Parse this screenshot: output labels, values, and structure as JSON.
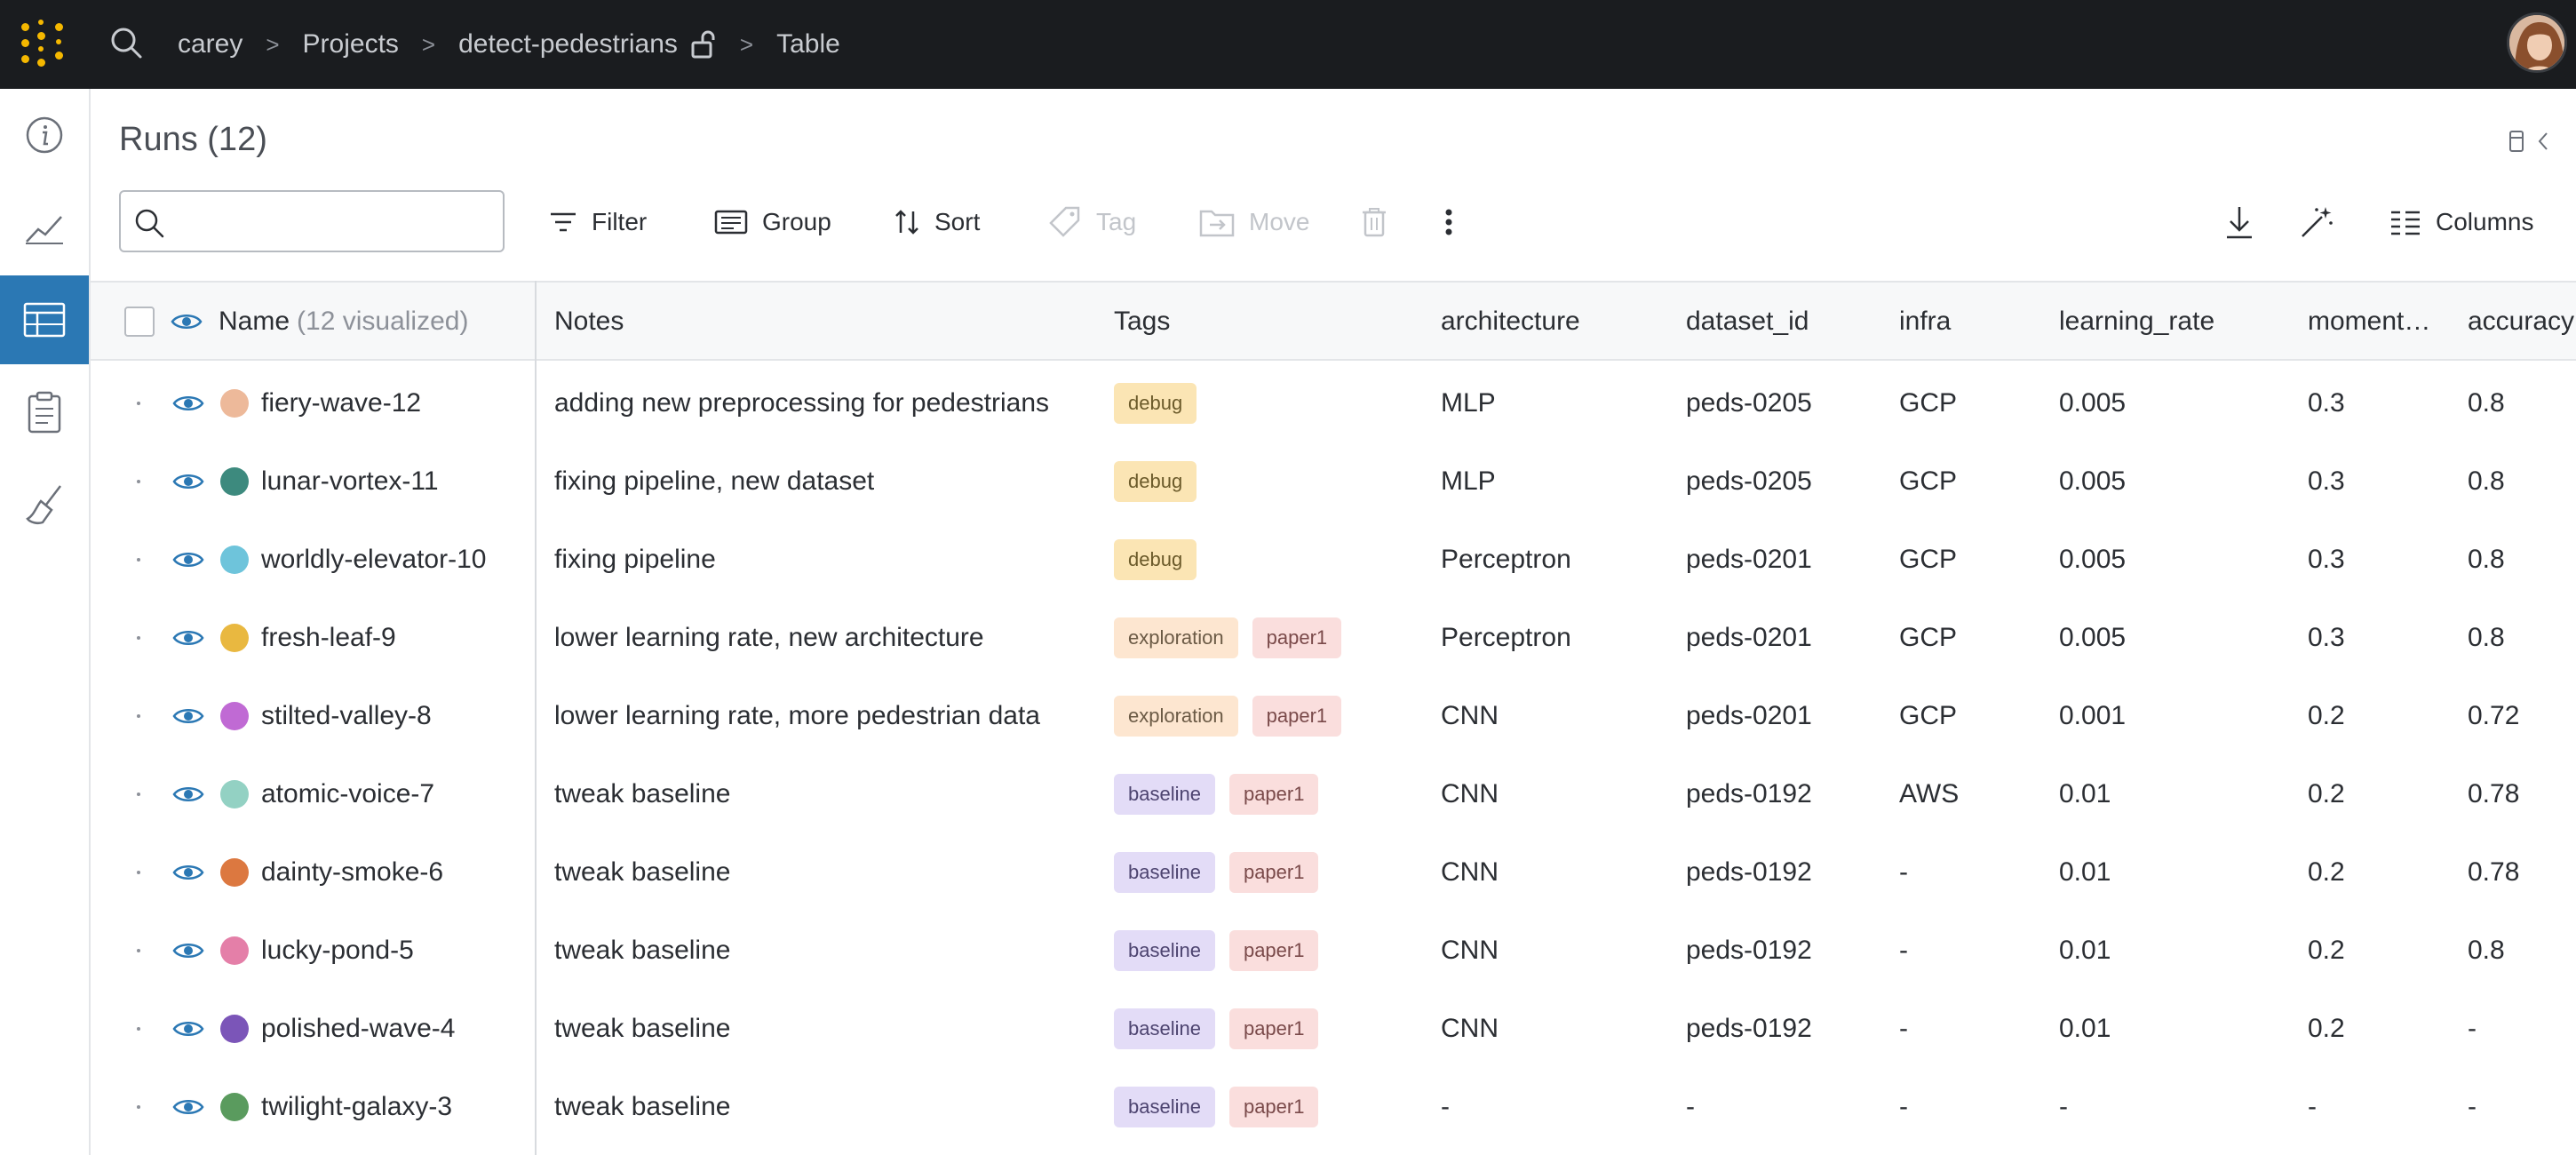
{
  "topbar": {
    "breadcrumbs": [
      "carey",
      "Projects",
      "detect-pedestrians",
      "Table"
    ]
  },
  "header": {
    "title": "Runs",
    "count": "(12)"
  },
  "search": {
    "placeholder": ""
  },
  "toolbar": {
    "filter": "Filter",
    "group": "Group",
    "sort": "Sort",
    "tag": "Tag",
    "move": "Move",
    "columns": "Columns"
  },
  "columns": {
    "name": "Name",
    "name_sub": "(12 visualized)",
    "notes": "Notes",
    "tags": "Tags",
    "architecture": "architecture",
    "dataset_id": "dataset_id",
    "infra": "infra",
    "learning_rate": "learning_rate",
    "momentum": "moment…",
    "accuracy": "accuracy"
  },
  "colors": {
    "topbar": "#1a1c1f",
    "accent": "#2b78b4",
    "logo": "#f5b800",
    "tag_debug_bg": "#fbe5b4",
    "tag_exploration_bg": "#fde6d0",
    "tag_paper1_bg": "#fadedd",
    "tag_baseline_bg": "#e3dcf7"
  },
  "rows": [
    {
      "name": "fiery-wave-12",
      "color": "#edb99a",
      "notes": "adding new preprocessing for pedestrians",
      "tags": [
        "debug"
      ],
      "architecture": "MLP",
      "dataset_id": "peds-0205",
      "infra": "GCP",
      "learning_rate": "0.005",
      "momentum": "0.3",
      "accuracy": "0.8"
    },
    {
      "name": "lunar-vortex-11",
      "color": "#3d8a7e",
      "notes": "fixing pipeline, new dataset",
      "tags": [
        "debug"
      ],
      "architecture": "MLP",
      "dataset_id": "peds-0205",
      "infra": "GCP",
      "learning_rate": "0.005",
      "momentum": "0.3",
      "accuracy": "0.8"
    },
    {
      "name": "worldly-elevator-10",
      "color": "#6ec4db",
      "notes": "fixing pipeline",
      "tags": [
        "debug"
      ],
      "architecture": "Perceptron",
      "dataset_id": "peds-0201",
      "infra": "GCP",
      "learning_rate": "0.005",
      "momentum": "0.3",
      "accuracy": "0.8"
    },
    {
      "name": "fresh-leaf-9",
      "color": "#e9b840",
      "notes": "lower learning rate, new architecture",
      "tags": [
        "exploration",
        "paper1"
      ],
      "architecture": "Perceptron",
      "dataset_id": "peds-0201",
      "infra": "GCP",
      "learning_rate": "0.005",
      "momentum": "0.3",
      "accuracy": "0.8"
    },
    {
      "name": "stilted-valley-8",
      "color": "#c06ad4",
      "notes": "lower learning rate, more pedestrian data",
      "tags": [
        "exploration",
        "paper1"
      ],
      "architecture": "CNN",
      "dataset_id": "peds-0201",
      "infra": "GCP",
      "learning_rate": "0.001",
      "momentum": "0.2",
      "accuracy": "0.72"
    },
    {
      "name": "atomic-voice-7",
      "color": "#93d1c3",
      "notes": "tweak baseline",
      "tags": [
        "baseline",
        "paper1"
      ],
      "architecture": "CNN",
      "dataset_id": "peds-0192",
      "infra": "AWS",
      "learning_rate": "0.01",
      "momentum": "0.2",
      "accuracy": "0.78"
    },
    {
      "name": "dainty-smoke-6",
      "color": "#dc7840",
      "notes": "tweak baseline",
      "tags": [
        "baseline",
        "paper1"
      ],
      "architecture": "CNN",
      "dataset_id": "peds-0192",
      "infra": "-",
      "learning_rate": "0.01",
      "momentum": "0.2",
      "accuracy": "0.78"
    },
    {
      "name": "lucky-pond-5",
      "color": "#e47fa8",
      "notes": "tweak baseline",
      "tags": [
        "baseline",
        "paper1"
      ],
      "architecture": "CNN",
      "dataset_id": "peds-0192",
      "infra": "-",
      "learning_rate": "0.01",
      "momentum": "0.2",
      "accuracy": "0.8"
    },
    {
      "name": "polished-wave-4",
      "color": "#7b55b8",
      "notes": "tweak baseline",
      "tags": [
        "baseline",
        "paper1"
      ],
      "architecture": "CNN",
      "dataset_id": "peds-0192",
      "infra": "-",
      "learning_rate": "0.01",
      "momentum": "0.2",
      "accuracy": "-"
    },
    {
      "name": "twilight-galaxy-3",
      "color": "#5a9b5e",
      "notes": "tweak baseline",
      "tags": [
        "baseline",
        "paper1"
      ],
      "architecture": "-",
      "dataset_id": "-",
      "infra": "-",
      "learning_rate": "-",
      "momentum": "-",
      "accuracy": "-"
    }
  ]
}
